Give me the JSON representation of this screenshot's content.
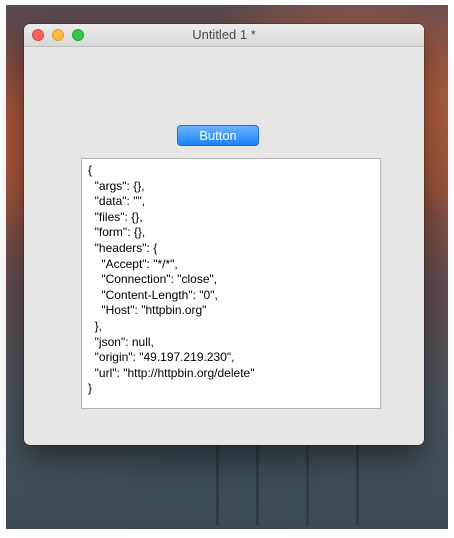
{
  "window": {
    "title": "Untitled 1 *"
  },
  "button": {
    "label": "Button"
  },
  "response": {
    "text": "{\n  \"args\": {},\n  \"data\": \"\",\n  \"files\": {},\n  \"form\": {},\n  \"headers\": {\n    \"Accept\": \"*/*\",\n    \"Connection\": \"close\",\n    \"Content-Length\": \"0\",\n    \"Host\": \"httpbin.org\"\n  },\n  \"json\": null,\n  \"origin\": \"49.197.219.230\",\n  \"url\": \"http://httpbin.org/delete\"\n}"
  },
  "colors": {
    "accent": "#1a82fb",
    "close": "#fc605c",
    "minimize": "#fdbc40",
    "maximize": "#34c84a"
  },
  "icons": [
    "close-traffic-light-icon",
    "minimize-traffic-light-icon",
    "maximize-traffic-light-icon"
  ]
}
